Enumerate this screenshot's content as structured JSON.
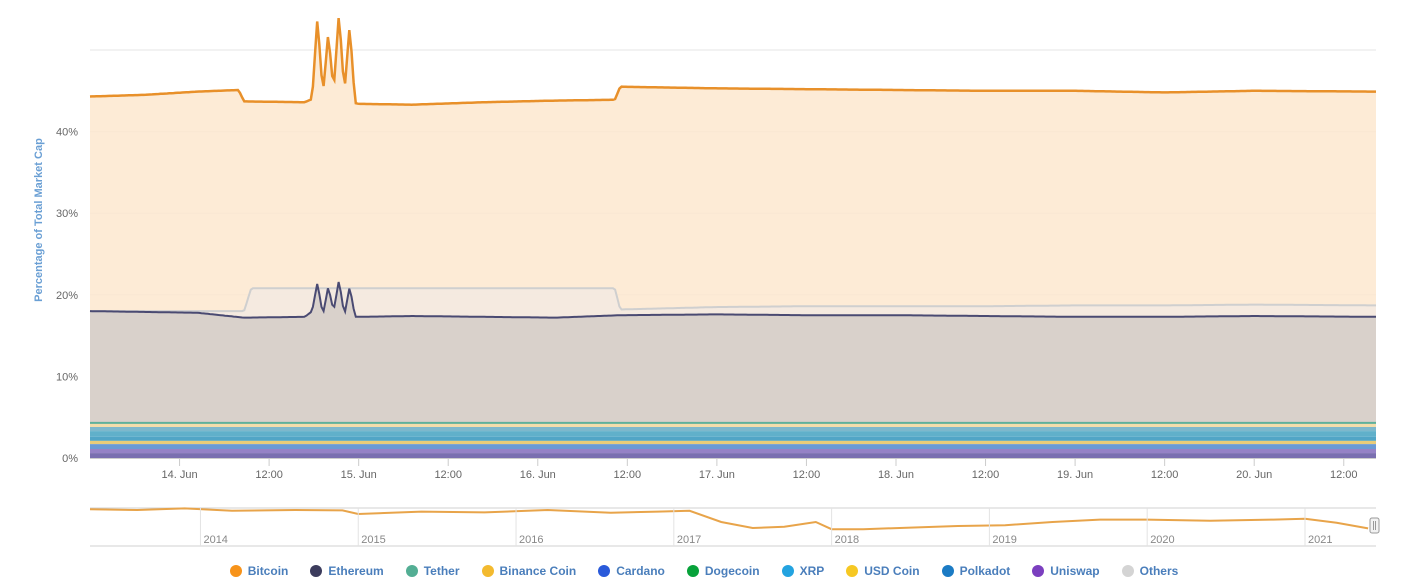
{
  "chart_data": [
    {
      "type": "area",
      "stacking": "percent-of-total",
      "ylabel": "Percentage of Total Market Cap",
      "ylim": [
        0,
        50
      ],
      "y_ticks": [
        "0%",
        "10%",
        "20%",
        "30%",
        "40%"
      ],
      "y_tick_values": [
        0,
        10,
        20,
        30,
        40
      ],
      "x_range": [
        0,
        6.5
      ],
      "x_ticks": [
        {
          "x": 0.5,
          "label": "14. Jun"
        },
        {
          "x": 1.0,
          "label": "12:00"
        },
        {
          "x": 1.5,
          "label": "15. Jun"
        },
        {
          "x": 2.0,
          "label": "12:00"
        },
        {
          "x": 2.5,
          "label": "16. Jun"
        },
        {
          "x": 3.0,
          "label": "12:00"
        },
        {
          "x": 3.5,
          "label": "17. Jun"
        },
        {
          "x": 4.0,
          "label": "12:00"
        },
        {
          "x": 4.5,
          "label": "18. Jun"
        },
        {
          "x": 5.0,
          "label": "12:00"
        },
        {
          "x": 5.5,
          "label": "19. Jun"
        },
        {
          "x": 6.0,
          "label": "12:00"
        },
        {
          "x": 6.5,
          "label": "20. Jun"
        },
        {
          "x": 7.0,
          "label": "12:00"
        }
      ],
      "x_axis_range_days": [
        0,
        7.18
      ],
      "grid": true,
      "legend_placement": "bottom",
      "series": [
        {
          "name": "Bitcoin",
          "color": "#f7931a",
          "line_color": "#e8902a",
          "x": [
            0,
            0.3,
            0.6,
            0.83,
            0.86,
            1.2,
            1.24,
            1.27,
            1.3,
            1.33,
            1.36,
            1.39,
            1.42,
            1.45,
            1.48,
            1.5,
            1.8,
            2.2,
            2.6,
            2.93,
            2.96,
            3.5,
            4.0,
            4.5,
            5.0,
            5.5,
            6.0,
            6.5,
            7.18
          ],
          "values": [
            44.3,
            44.5,
            44.9,
            45.1,
            43.7,
            43.6,
            44.0,
            54.0,
            44.5,
            52.0,
            45.0,
            54.5,
            44.8,
            53.0,
            43.5,
            43.4,
            43.3,
            43.6,
            43.8,
            43.9,
            45.5,
            45.3,
            45.2,
            45.1,
            45.0,
            45.0,
            44.8,
            45.0,
            44.9
          ]
        },
        {
          "name": "Ethereum",
          "color": "#d7d1cc",
          "line_color": "#4a4a72",
          "x": [
            0,
            0.3,
            0.6,
            0.86,
            1.2,
            1.24,
            1.27,
            1.3,
            1.33,
            1.36,
            1.39,
            1.42,
            1.45,
            1.48,
            1.5,
            1.8,
            2.2,
            2.6,
            2.96,
            3.5,
            4.0,
            4.5,
            5.0,
            5.5,
            6.0,
            6.5,
            7.18
          ],
          "values": [
            18.0,
            17.9,
            17.8,
            17.2,
            17.3,
            18.0,
            21.5,
            17.5,
            21.0,
            18.0,
            21.8,
            17.5,
            21.0,
            17.3,
            17.3,
            17.4,
            17.3,
            17.2,
            17.5,
            17.6,
            17.5,
            17.5,
            17.4,
            17.3,
            17.3,
            17.4,
            17.3
          ]
        },
        {
          "name": "Tether",
          "color": "#53ae94",
          "values_pct": 4.2
        },
        {
          "name": "Binance Coin",
          "color": "#f3ba2f",
          "values_pct": 3.8
        },
        {
          "name": "Cardano",
          "color": "#2a5ada",
          "values_pct": 3.3
        },
        {
          "name": "Dogecoin",
          "color": "#07a23a",
          "values_pct": 2.6
        },
        {
          "name": "XRP",
          "color": "#23a3e0",
          "values_pct": 2.1
        },
        {
          "name": "USD Coin",
          "color": "#f6c823",
          "values_pct": 1.7
        },
        {
          "name": "Polkadot",
          "color": "#1b7bc4",
          "values_pct": 1.1
        },
        {
          "name": "Uniswap",
          "color": "#7b3fbf",
          "values_pct": 0.6
        },
        {
          "name": "Others",
          "color": "#d4d4d4",
          "line_color": "#c8c8c8",
          "x": [
            0,
            0.86,
            0.9,
            1.5,
            2.0,
            2.5,
            2.93,
            2.96,
            3.5,
            4.0,
            4.5,
            5.0,
            5.5,
            6.0,
            6.5,
            7.18
          ],
          "values": [
            18.0,
            18.0,
            20.8,
            20.8,
            20.8,
            20.8,
            20.8,
            18.2,
            18.5,
            18.6,
            18.6,
            18.6,
            18.7,
            18.7,
            18.8,
            18.7
          ]
        }
      ]
    },
    {
      "type": "line",
      "role": "navigator",
      "x_ticks": [
        "2014",
        "2015",
        "2016",
        "2017",
        "2018",
        "2019",
        "2020",
        "2021"
      ],
      "series": [
        {
          "name": "Bitcoin",
          "color": "#e8a44a",
          "x": [
            2013.3,
            2013.6,
            2013.9,
            2014.2,
            2014.6,
            2014.9,
            2015.0,
            2015.4,
            2015.8,
            2016.2,
            2016.6,
            2016.9,
            2017.1,
            2017.3,
            2017.5,
            2017.7,
            2017.9,
            2018.0,
            2018.2,
            2018.5,
            2018.8,
            2019.1,
            2019.4,
            2019.7,
            2020.0,
            2020.4,
            2020.8,
            2021.0,
            2021.2,
            2021.4
          ],
          "values": [
            92,
            90,
            94,
            88,
            90,
            89,
            80,
            86,
            84,
            90,
            83,
            86,
            88,
            60,
            45,
            48,
            60,
            42,
            42,
            46,
            50,
            52,
            60,
            66,
            66,
            63,
            66,
            68,
            58,
            44
          ]
        }
      ]
    }
  ],
  "legend": [
    {
      "label": "Bitcoin",
      "color": "#f7931a"
    },
    {
      "label": "Ethereum",
      "color": "#3c3c5d"
    },
    {
      "label": "Tether",
      "color": "#53ae94"
    },
    {
      "label": "Binance Coin",
      "color": "#f3ba2f"
    },
    {
      "label": "Cardano",
      "color": "#2a5ada"
    },
    {
      "label": "Dogecoin",
      "color": "#07a23a"
    },
    {
      "label": "XRP",
      "color": "#23a3e0"
    },
    {
      "label": "USD Coin",
      "color": "#f6c823"
    },
    {
      "label": "Polkadot",
      "color": "#1b7bc4"
    },
    {
      "label": "Uniswap",
      "color": "#7b3fbf"
    },
    {
      "label": "Others",
      "color": "#d4d4d4"
    }
  ]
}
